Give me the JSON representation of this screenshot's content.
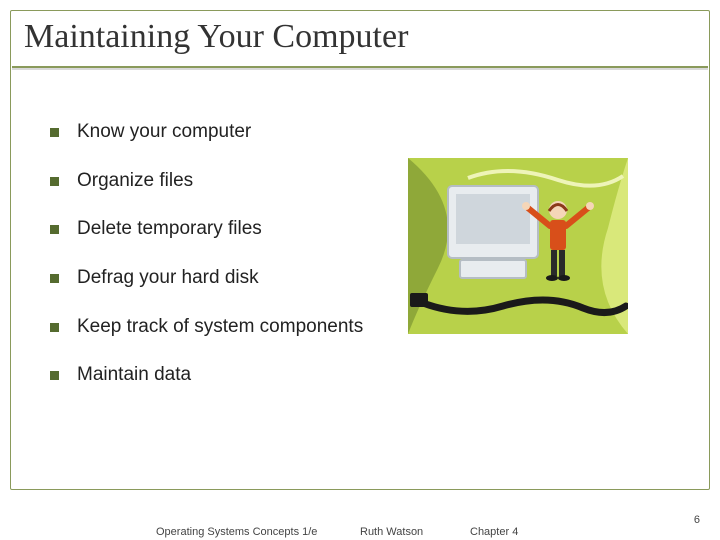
{
  "title": "Maintaining Your Computer",
  "bullets": [
    "Know your computer",
    "Organize files",
    "Delete temporary files",
    "Defrag your hard disk",
    "Keep track of system components",
    "Maintain data"
  ],
  "footer": {
    "book": "Operating Systems Concepts 1/e",
    "author": "Ruth Watson",
    "chapter": "Chapter 4"
  },
  "page_number": "6"
}
